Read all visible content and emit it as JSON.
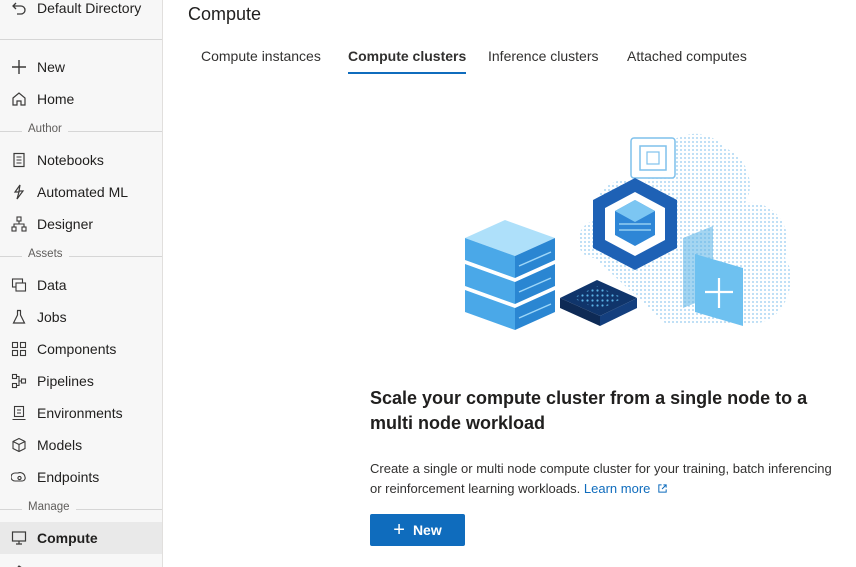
{
  "sidebar": {
    "directory": "Default Directory",
    "items": {
      "new": {
        "label": "New",
        "icon": "plus-icon"
      },
      "home": {
        "label": "Home",
        "icon": "home-icon"
      },
      "notebooks": {
        "label": "Notebooks",
        "icon": "notebook-icon"
      },
      "automl": {
        "label": "Automated ML",
        "icon": "automated-ml-icon"
      },
      "designer": {
        "label": "Designer",
        "icon": "designer-icon"
      },
      "data": {
        "label": "Data",
        "icon": "data-icon"
      },
      "jobs": {
        "label": "Jobs",
        "icon": "flask-icon"
      },
      "components": {
        "label": "Components",
        "icon": "components-icon"
      },
      "pipelines": {
        "label": "Pipelines",
        "icon": "pipelines-icon"
      },
      "environments": {
        "label": "Environments",
        "icon": "environments-icon"
      },
      "models": {
        "label": "Models",
        "icon": "cube-icon"
      },
      "endpoints": {
        "label": "Endpoints",
        "icon": "endpoints-icon"
      },
      "compute": {
        "label": "Compute",
        "icon": "monitor-icon"
      }
    },
    "sections": {
      "author": "Author",
      "assets": "Assets",
      "manage": "Manage"
    }
  },
  "main": {
    "title": "Compute",
    "tabs": [
      {
        "label": "Compute instances"
      },
      {
        "label": "Compute clusters"
      },
      {
        "label": "Inference clusters"
      },
      {
        "label": "Attached computes"
      }
    ],
    "active_tab": "Compute clusters",
    "headline": "Scale your compute cluster from a single node to a multi node workload",
    "description": "Create a single or multi node compute cluster for your training, batch inferencing or reinforcement learning workloads.",
    "learn_more": "Learn more",
    "new_button": "New"
  },
  "colors": {
    "accent": "#0f6cbd",
    "sidebar_bg": "#f7f7f7",
    "active_item_bg": "#e9e9e9"
  }
}
